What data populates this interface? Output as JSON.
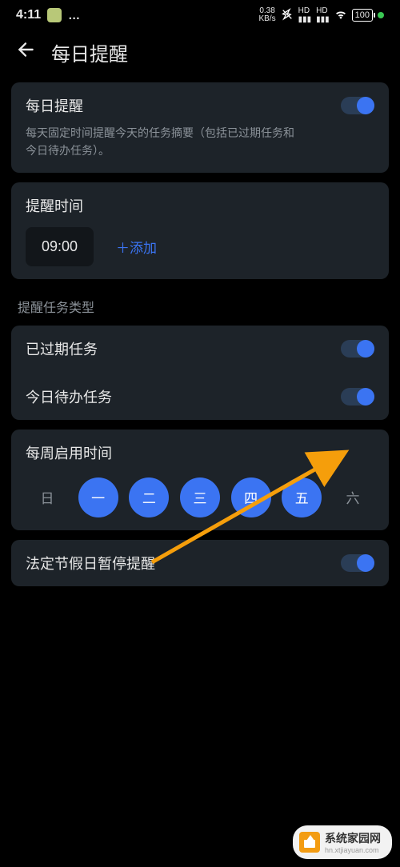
{
  "status": {
    "time": "4:11",
    "dots": "…",
    "speed_value": "0.38",
    "speed_unit": "KB/s",
    "battery": "100"
  },
  "header": {
    "title": "每日提醒"
  },
  "daily": {
    "title": "每日提醒",
    "desc": "每天固定时间提醒今天的任务摘要（包括已过期任务和今日待办任务）。"
  },
  "remind_time": {
    "label": "提醒时间",
    "value": "09:00",
    "add": "＋添加"
  },
  "section_task_type": "提醒任务类型",
  "tasks": {
    "overdue": "已过期任务",
    "today": "今日待办任务"
  },
  "weekly": {
    "label": "每周启用时间",
    "days": [
      "日",
      "一",
      "二",
      "三",
      "四",
      "五",
      "六"
    ]
  },
  "holiday": {
    "label": "法定节假日暂停提醒"
  },
  "watermark": {
    "name": "系统家园网",
    "url": "hn.xtjiayuan.com"
  }
}
